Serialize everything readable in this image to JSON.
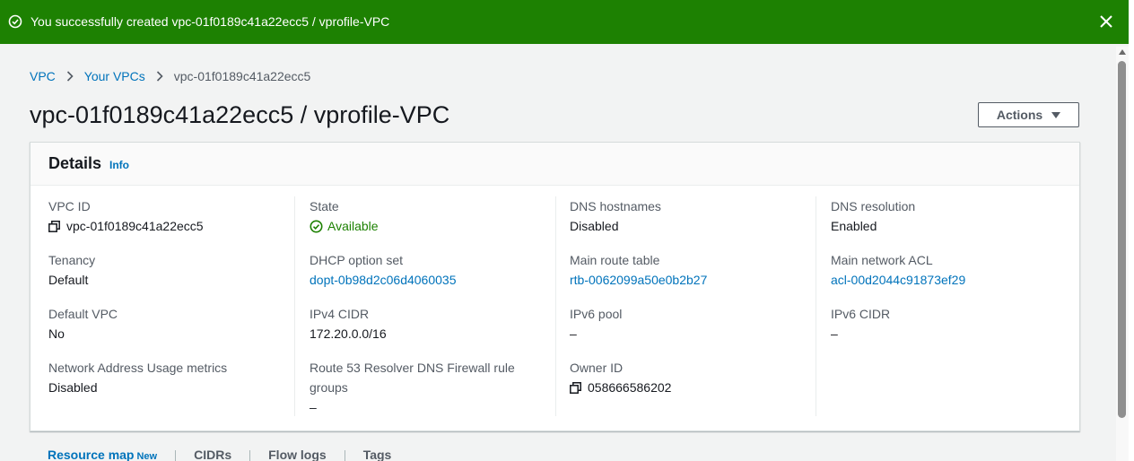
{
  "banner": {
    "message": "You successfully created vpc-01f0189c41a22ecc5 / vprofile-VPC",
    "bg_color": "#1d8102"
  },
  "breadcrumb": {
    "items": [
      "VPC",
      "Your VPCs",
      "vpc-01f0189c41a22ecc5"
    ]
  },
  "page": {
    "title": "vpc-01f0189c41a22ecc5 / vprofile-VPC",
    "actions_label": "Actions"
  },
  "details": {
    "title": "Details",
    "info_label": "Info",
    "columns": [
      [
        {
          "label": "VPC ID",
          "value": "vpc-01f0189c41a22ecc5"
        },
        {
          "label": "Tenancy",
          "value": "Default"
        },
        {
          "label": "Default VPC",
          "value": "No"
        },
        {
          "label": "Network Address Usage metrics",
          "value": "Disabled"
        }
      ],
      [
        {
          "label": "State",
          "value": "Available"
        },
        {
          "label": "DHCP option set",
          "value": "dopt-0b98d2c06d4060035"
        },
        {
          "label": "IPv4 CIDR",
          "value": "172.20.0.0/16"
        },
        {
          "label_line1": "Route 53 Resolver DNS Firewall rule",
          "label_line2": "groups",
          "value": "–"
        }
      ],
      [
        {
          "label": "DNS hostnames",
          "value": "Disabled"
        },
        {
          "label": "Main route table",
          "value": "rtb-0062099a50e0b2b27"
        },
        {
          "label": "IPv6 pool",
          "value": "–"
        },
        {
          "label": "Owner ID",
          "value": "058666586202"
        }
      ],
      [
        {
          "label": "DNS resolution",
          "value": "Enabled"
        },
        {
          "label": "Main network ACL",
          "value": "acl-00d2044c91873ef29"
        },
        {
          "label": "IPv6 CIDR",
          "value": "–"
        }
      ]
    ]
  },
  "tabs": [
    {
      "label": "Resource map",
      "badge": "New"
    },
    {
      "label": "CIDRs"
    },
    {
      "label": "Flow logs"
    },
    {
      "label": "Tags"
    }
  ],
  "colors": {
    "link": "#0073bb",
    "success": "#1d8102",
    "text": "#16191f",
    "label": "#545b64"
  }
}
